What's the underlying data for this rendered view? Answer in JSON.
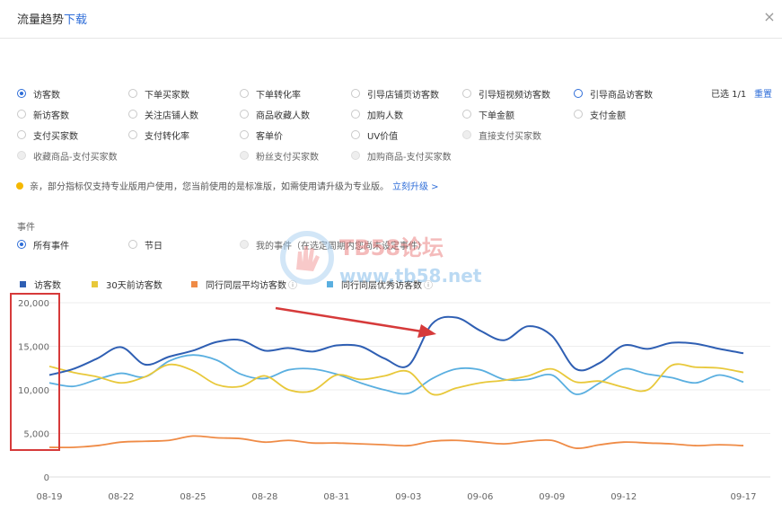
{
  "dialog": {
    "title": "流量趋势",
    "download": "下载",
    "close_glyph": "×"
  },
  "metrics": [
    {
      "label": "访客数",
      "state": "selected"
    },
    {
      "label": "下单买家数",
      "state": "normal"
    },
    {
      "label": "下单转化率",
      "state": "normal"
    },
    {
      "label": "引导店铺页访客数",
      "state": "normal"
    },
    {
      "label": "引导短视频访客数",
      "state": "normal"
    },
    {
      "label": "引导商品访客数",
      "state": "highlight"
    },
    {
      "label": "新访客数",
      "state": "normal"
    },
    {
      "label": "关注店铺人数",
      "state": "normal"
    },
    {
      "label": "商品收藏人数",
      "state": "normal"
    },
    {
      "label": "加购人数",
      "state": "normal"
    },
    {
      "label": "下单金额",
      "state": "normal"
    },
    {
      "label": "支付金额",
      "state": "normal"
    },
    {
      "label": "支付买家数",
      "state": "normal"
    },
    {
      "label": "支付转化率",
      "state": "normal"
    },
    {
      "label": "客单价",
      "state": "normal"
    },
    {
      "label": "UV价值",
      "state": "normal"
    },
    {
      "label": "直接支付买家数",
      "state": "disabled"
    },
    {
      "label": "收藏商品-支付买家数",
      "state": "disabled"
    },
    {
      "label": "粉丝支付买家数",
      "state": "disabled"
    },
    {
      "label": "加购商品-支付买家数",
      "state": "disabled"
    }
  ],
  "selection": {
    "count": "已选 1/1",
    "reset": "重置"
  },
  "notice": {
    "text": "亲，部分指标仅支持专业版用户使用，您当前使用的是标准版，如需使用请升级为专业版。",
    "link": "立刻升级 >"
  },
  "events": {
    "label": "事件",
    "options": [
      {
        "label": "所有事件",
        "state": "selected"
      },
      {
        "label": "节日",
        "state": "normal"
      },
      {
        "label": "我的事件（在选定周期内您尚未设定事件）",
        "state": "disabled"
      }
    ]
  },
  "watermark": {
    "line1": "TB58论坛",
    "line2": "www.tb58.net"
  },
  "colors": {
    "accent": "#2e6dd8",
    "annotation": "#d63a3a"
  },
  "chart_data": {
    "type": "line",
    "yticks": [
      "20,000",
      "15,000",
      "10,000",
      "5,000",
      "0"
    ],
    "ylim": [
      0,
      20000
    ],
    "x": [
      "08-19",
      "08-20",
      "08-21",
      "08-22",
      "08-23",
      "08-24",
      "08-25",
      "08-26",
      "08-27",
      "08-28",
      "08-29",
      "08-30",
      "08-31",
      "09-01",
      "09-02",
      "09-03",
      "09-04",
      "09-05",
      "09-06",
      "09-07",
      "09-08",
      "09-09",
      "09-10",
      "09-11",
      "09-12",
      "09-13",
      "09-14",
      "09-15",
      "09-16",
      "09-17"
    ],
    "xticks": [
      "08-19",
      "08-22",
      "08-25",
      "08-28",
      "08-31",
      "09-03",
      "09-06",
      "09-09",
      "09-12",
      "09-17"
    ],
    "series": [
      {
        "name": "访客数",
        "color": "#2f5fb3",
        "values": [
          11700,
          12400,
          13600,
          14900,
          12900,
          13800,
          14500,
          15500,
          15700,
          14500,
          14800,
          14400,
          15100,
          15000,
          13600,
          12800,
          17600,
          18300,
          16800,
          15700,
          17300,
          16200,
          12400,
          13100,
          15100,
          14700,
          15400,
          15300,
          14700,
          14200
        ]
      },
      {
        "name": "30天前访客数",
        "color": "#e8c83a",
        "values": [
          12700,
          12000,
          11500,
          10800,
          11500,
          12900,
          12200,
          10600,
          10400,
          11600,
          10000,
          9900,
          11700,
          11200,
          11600,
          12100,
          9500,
          10200,
          10800,
          11100,
          11600,
          12400,
          10900,
          11000,
          10300,
          10000,
          12800,
          12600,
          12500,
          12000
        ]
      },
      {
        "name": "同行同层平均访客数",
        "color": "#ef8b46",
        "values": [
          3400,
          3400,
          3600,
          4000,
          4100,
          4200,
          4700,
          4500,
          4400,
          4000,
          4200,
          3900,
          3900,
          3800,
          3700,
          3600,
          4100,
          4200,
          4000,
          3800,
          4100,
          4200,
          3300,
          3700,
          4000,
          3900,
          3800,
          3600,
          3700,
          3600
        ]
      },
      {
        "name": "同行同层优秀访客数",
        "color": "#5aafe0",
        "values": [
          10800,
          10400,
          11200,
          11900,
          11500,
          13300,
          14000,
          13400,
          11800,
          11300,
          12300,
          12400,
          11800,
          10800,
          10000,
          9600,
          11300,
          12400,
          12300,
          11200,
          11200,
          11700,
          9500,
          10800,
          12400,
          11800,
          11400,
          10800,
          11700,
          10900
        ]
      }
    ],
    "legend_suffix": "ⓘ"
  }
}
